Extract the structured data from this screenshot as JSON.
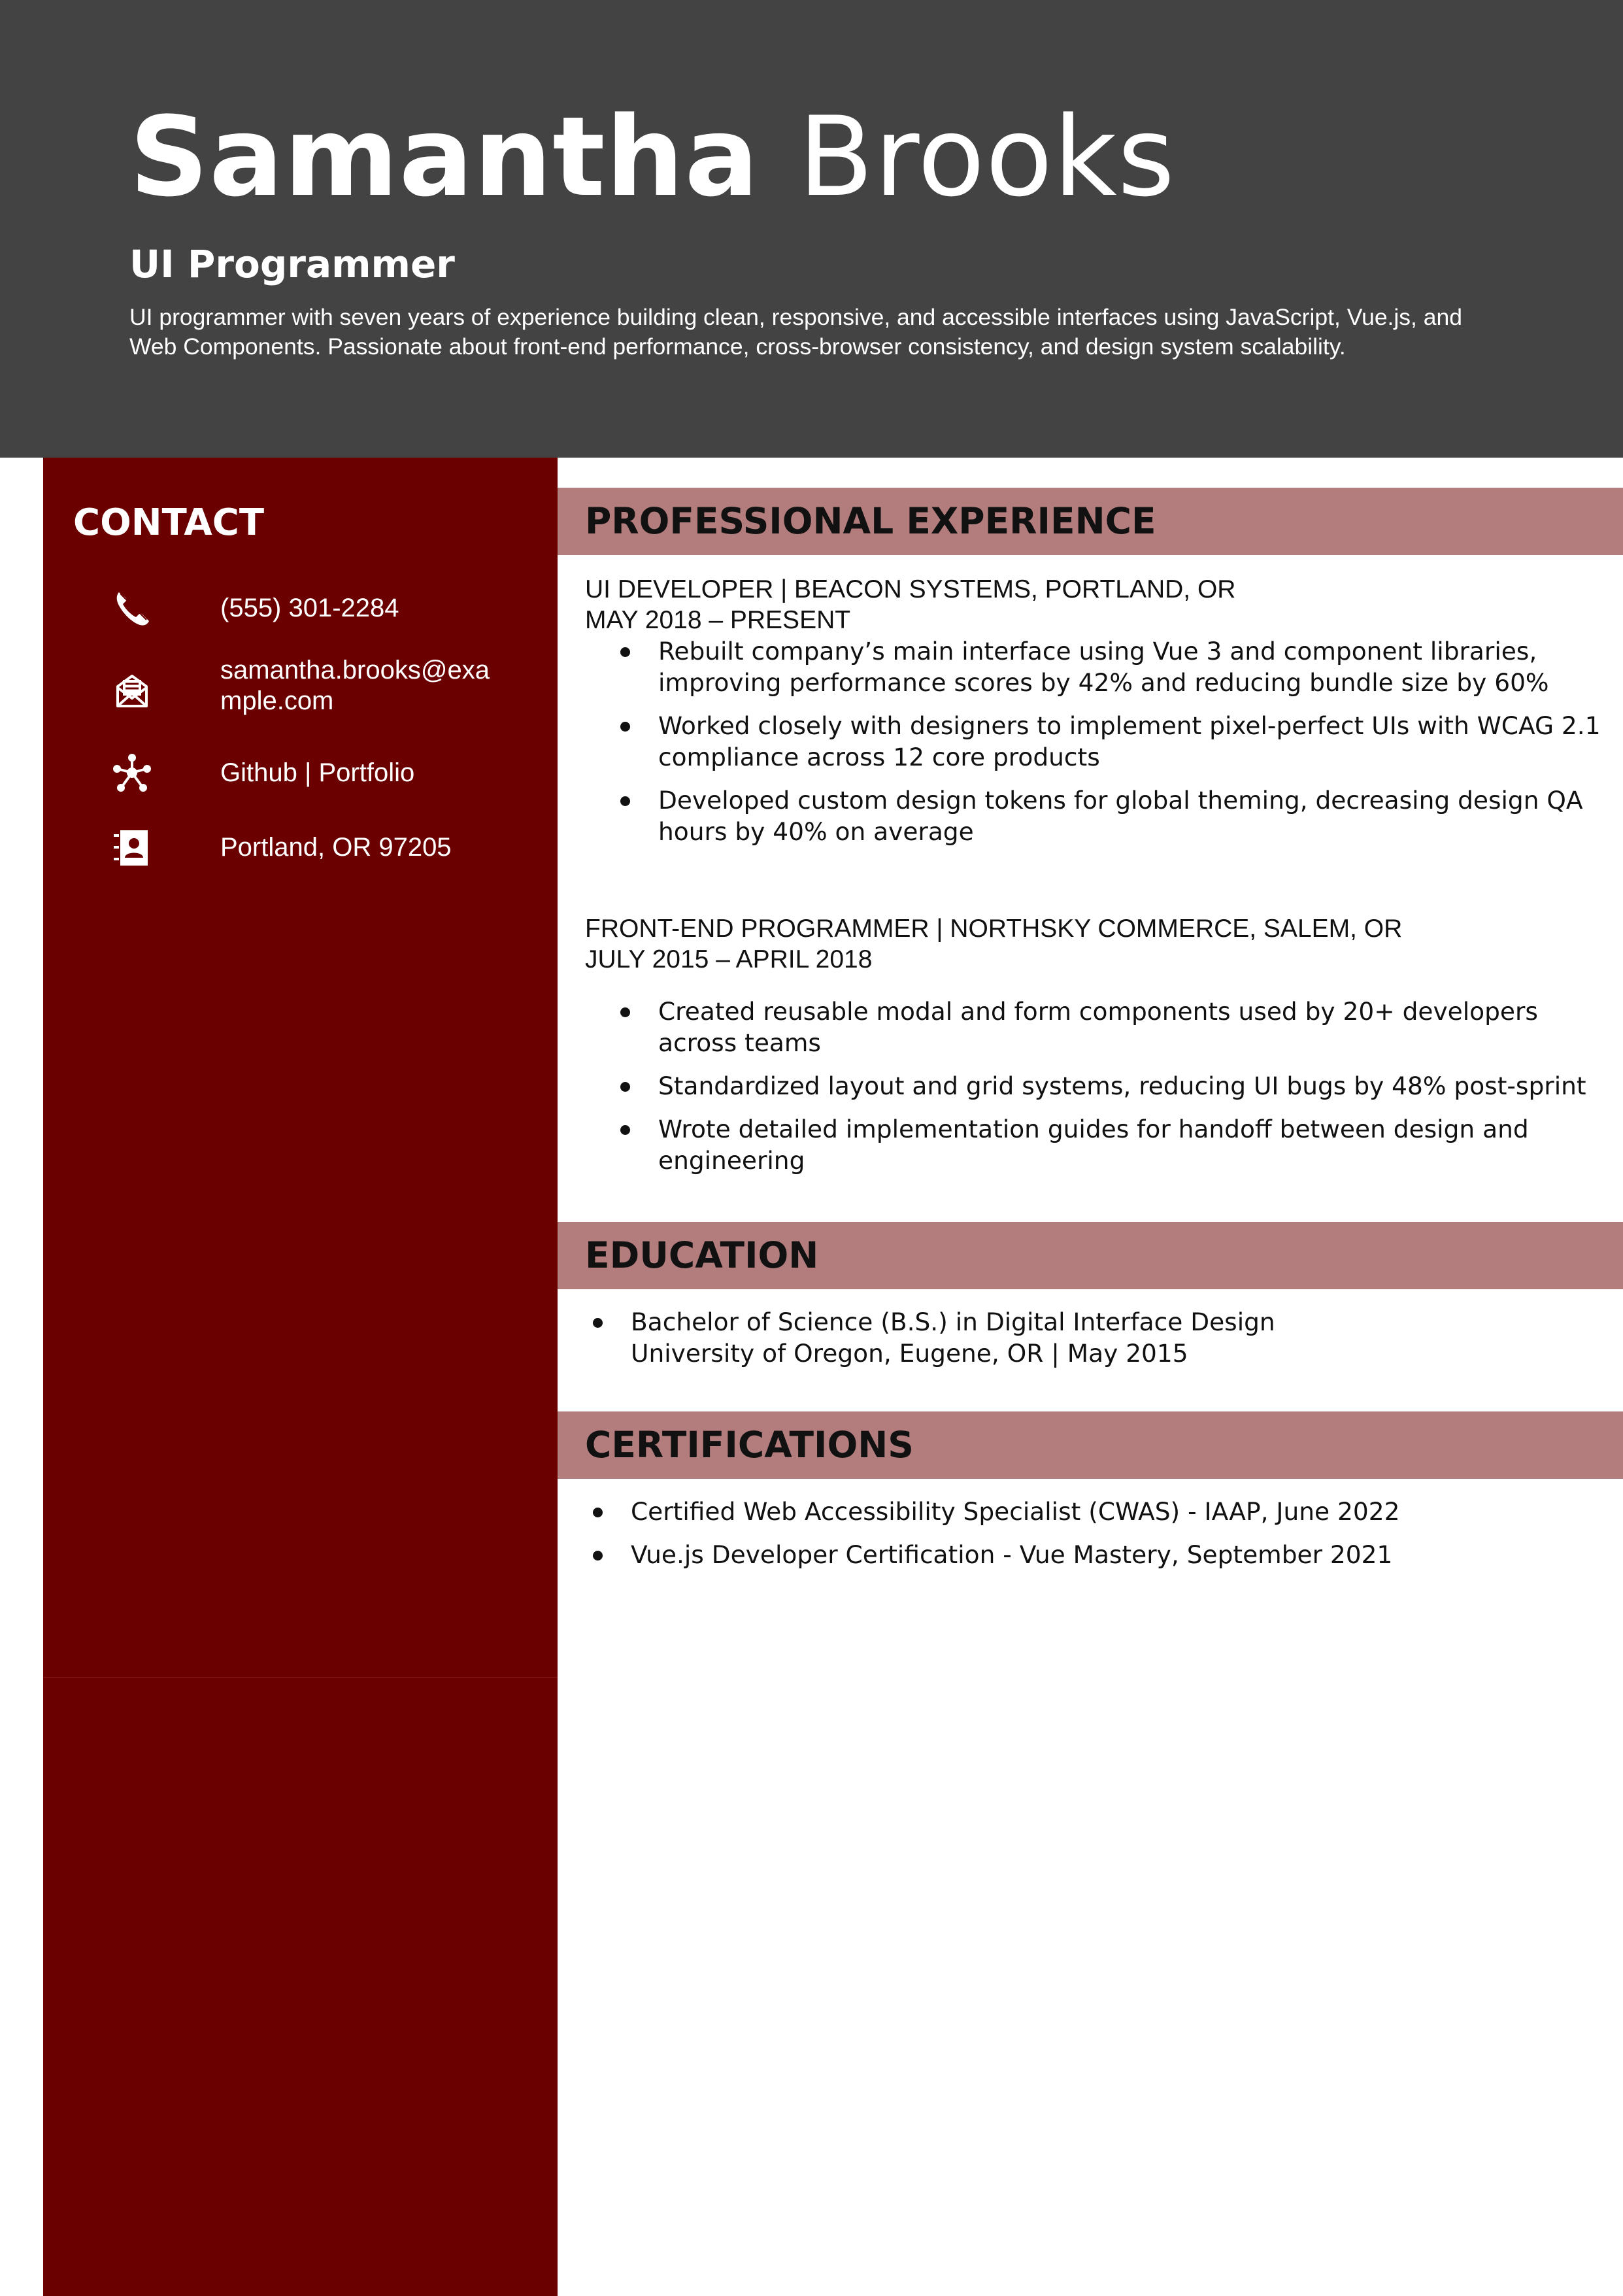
{
  "header": {
    "first_name": "Samantha",
    "last_name": "Brooks",
    "job_title": "UI Programmer",
    "summary": "UI programmer with seven years of experience building clean, responsive, and accessible interfaces using JavaScript, Vue.js, and Web Components. Passionate about front-end performance, cross-browser consistency, and design system scalability."
  },
  "contact": {
    "title": "CONTACT",
    "items": [
      {
        "icon": "phone-icon",
        "text": "(555) 301-2284"
      },
      {
        "icon": "email-icon",
        "text": "samantha.brooks@example.com"
      },
      {
        "icon": "network-icon",
        "text": "Github | Portfolio"
      },
      {
        "icon": "address-card-icon",
        "text": "Portland, OR 97205"
      }
    ]
  },
  "experience": {
    "title": "PROFESSIONAL EXPERIENCE",
    "jobs": [
      {
        "heading": "UI DEVELOPER | BEACON SYSTEMS, PORTLAND, OR",
        "dates": "MAY 2018 – PRESENT",
        "bullets": [
          "Rebuilt company’s main interface using Vue 3 and component libraries, improving performance scores by 42% and reducing bundle size by 60%",
          "Worked closely with designers to implement pixel-perfect UIs with WCAG 2.1 compliance across 12 core products",
          "Developed custom design tokens for global theming, decreasing design QA hours by 40% on average"
        ]
      },
      {
        "heading": "FRONT-END PROGRAMMER | NORTHSKY COMMERCE, SALEM, OR",
        "dates": "JULY 2015 – APRIL 2018",
        "bullets": [
          "Created reusable modal and form components used by 20+ developers across teams",
          "Standardized layout and grid systems, reducing UI bugs by 48% post-sprint",
          "Wrote detailed implementation guides for handoff between design and engineering"
        ]
      }
    ]
  },
  "education": {
    "title": "EDUCATION",
    "items": [
      {
        "degree": "Bachelor of Science (B.S.) in Digital Interface Design",
        "school": "University of Oregon, Eugene, OR | May 2015"
      }
    ]
  },
  "certifications": {
    "title": "CERTIFICATIONS",
    "items": [
      "Certified Web Accessibility Specialist (CWAS) - IAAP, June 2022",
      "Vue.js Developer Certification - Vue Mastery, September 2021"
    ]
  },
  "colors": {
    "header_bg": "#434343",
    "sidebar_bg": "#6b0000",
    "section_bar": "#b37d7d",
    "text": "#111111",
    "on_dark": "#ffffff"
  }
}
